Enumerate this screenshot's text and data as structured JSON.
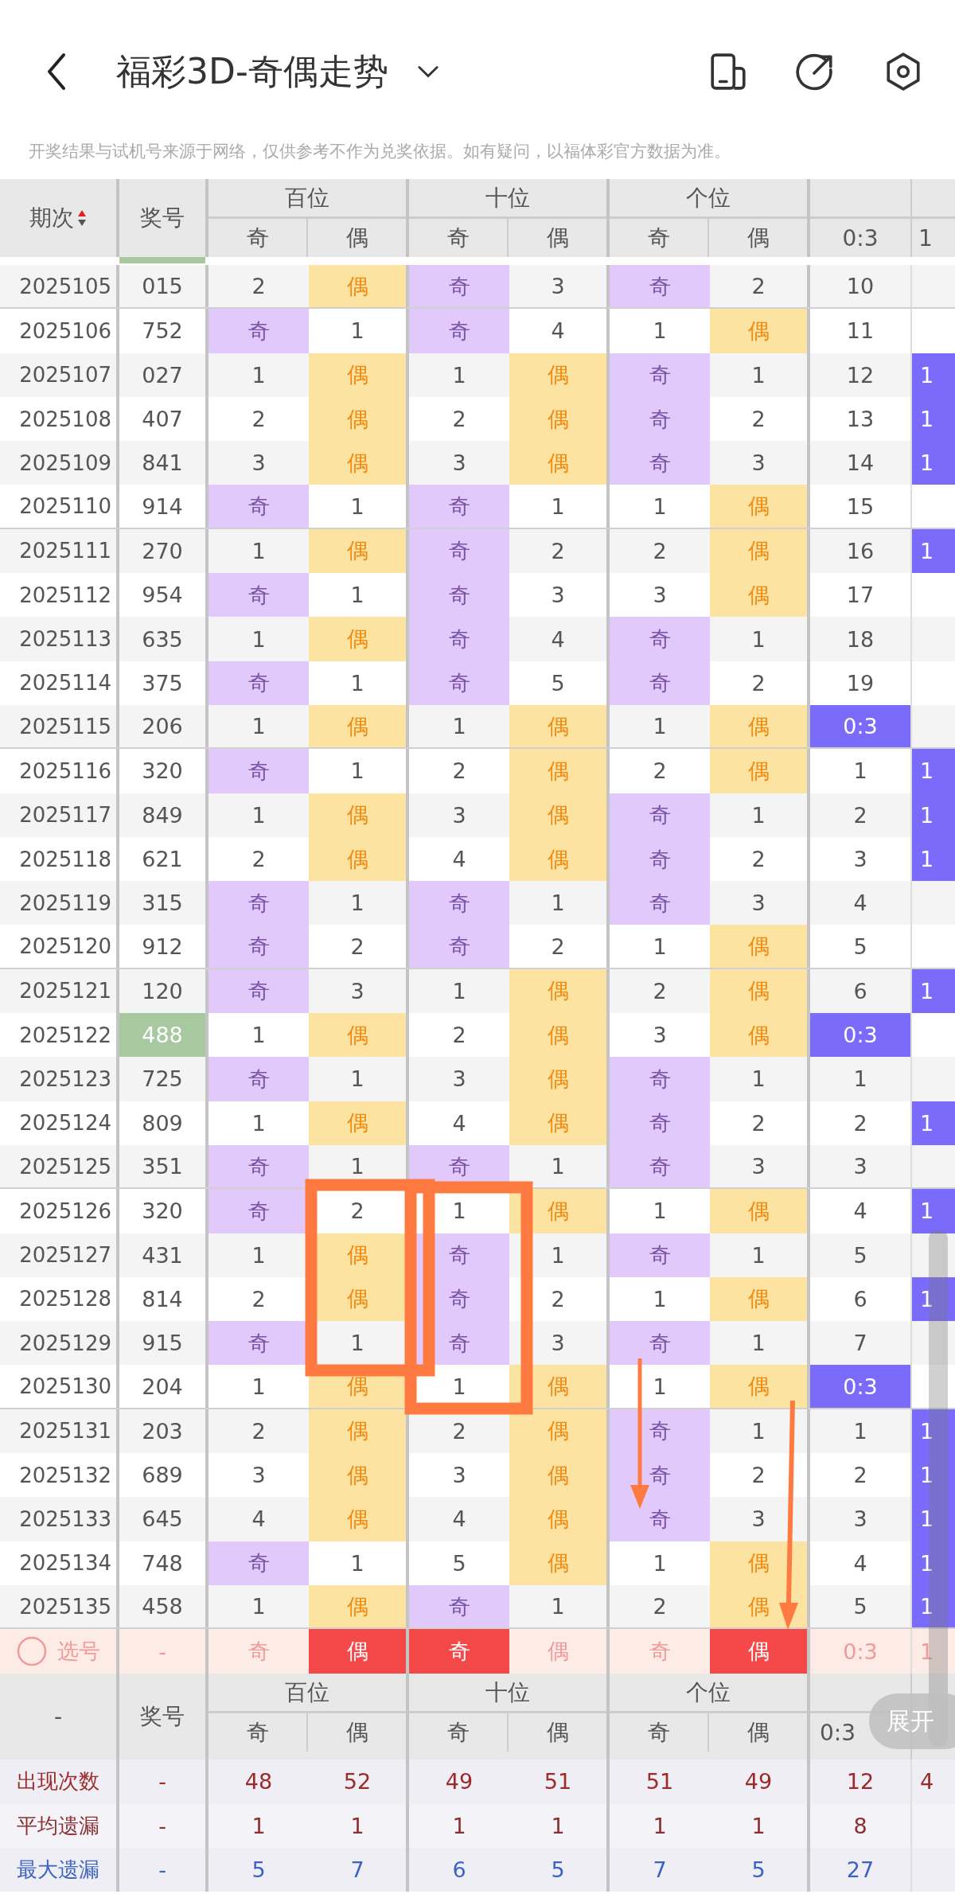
{
  "header": {
    "title": "福彩3D-奇偶走势"
  },
  "disclaimer": "开奖结果与试机号来源于网络，仅供参考不作为兑奖依据。如有疑问，以福体彩官方数据为准。",
  "table": {
    "period_label": "期次",
    "number_label": "奖号",
    "groups": [
      {
        "label": "百位",
        "odd": "奇",
        "even": "偶"
      },
      {
        "label": "十位",
        "odd": "奇",
        "even": "偶"
      },
      {
        "label": "个位",
        "odd": "奇",
        "even": "偶"
      }
    ],
    "ratio_columns": [
      "0:3",
      "1"
    ],
    "rows": [
      {
        "period": "2025105",
        "number": "015",
        "highlighted": false,
        "cells": [
          "2",
          "偶",
          "奇",
          "3",
          "奇",
          "2"
        ],
        "hits": [
          false,
          true,
          true,
          false,
          true,
          false
        ],
        "ratio": "10",
        "ratio_hit": false,
        "column_9_hit": false
      },
      {
        "period": "2025106",
        "number": "752",
        "highlighted": false,
        "cells": [
          "奇",
          "1",
          "奇",
          "4",
          "1",
          "偶"
        ],
        "hits": [
          true,
          false,
          true,
          false,
          false,
          true
        ],
        "ratio": "11",
        "ratio_hit": false,
        "column_9_hit": false
      },
      {
        "period": "2025107",
        "number": "027",
        "highlighted": false,
        "cells": [
          "1",
          "偶",
          "1",
          "偶",
          "奇",
          "1"
        ],
        "hits": [
          false,
          true,
          false,
          true,
          true,
          false
        ],
        "ratio": "12",
        "ratio_hit": false,
        "column_9_hit": true,
        "column_9": "1"
      },
      {
        "period": "2025108",
        "number": "407",
        "highlighted": false,
        "cells": [
          "2",
          "偶",
          "2",
          "偶",
          "奇",
          "2"
        ],
        "hits": [
          false,
          true,
          false,
          true,
          true,
          false
        ],
        "ratio": "13",
        "ratio_hit": false,
        "column_9_hit": true,
        "column_9": "1"
      },
      {
        "period": "2025109",
        "number": "841",
        "highlighted": false,
        "cells": [
          "3",
          "偶",
          "3",
          "偶",
          "奇",
          "3"
        ],
        "hits": [
          false,
          true,
          false,
          true,
          true,
          false
        ],
        "ratio": "14",
        "ratio_hit": false,
        "column_9_hit": true,
        "column_9": "1"
      },
      {
        "period": "2025110",
        "number": "914",
        "highlighted": false,
        "cells": [
          "奇",
          "1",
          "奇",
          "1",
          "1",
          "偶"
        ],
        "hits": [
          true,
          false,
          true,
          false,
          false,
          true
        ],
        "ratio": "15",
        "ratio_hit": false,
        "column_9_hit": false
      },
      {
        "period": "2025111",
        "number": "270",
        "highlighted": false,
        "cells": [
          "1",
          "偶",
          "奇",
          "2",
          "2",
          "偶"
        ],
        "hits": [
          false,
          true,
          true,
          false,
          false,
          true
        ],
        "ratio": "16",
        "ratio_hit": false,
        "column_9_hit": true,
        "column_9": "1"
      },
      {
        "period": "2025112",
        "number": "954",
        "highlighted": false,
        "cells": [
          "奇",
          "1",
          "奇",
          "3",
          "3",
          "偶"
        ],
        "hits": [
          true,
          false,
          true,
          false,
          false,
          true
        ],
        "ratio": "17",
        "ratio_hit": false,
        "column_9_hit": false
      },
      {
        "period": "2025113",
        "number": "635",
        "highlighted": false,
        "cells": [
          "1",
          "偶",
          "奇",
          "4",
          "奇",
          "1"
        ],
        "hits": [
          false,
          true,
          true,
          false,
          true,
          false
        ],
        "ratio": "18",
        "ratio_hit": false,
        "column_9_hit": false
      },
      {
        "period": "2025114",
        "number": "375",
        "highlighted": false,
        "cells": [
          "奇",
          "1",
          "奇",
          "5",
          "奇",
          "2"
        ],
        "hits": [
          true,
          false,
          true,
          false,
          true,
          false
        ],
        "ratio": "19",
        "ratio_hit": false,
        "column_9_hit": false
      },
      {
        "period": "2025115",
        "number": "206",
        "highlighted": false,
        "cells": [
          "1",
          "偶",
          "1",
          "偶",
          "1",
          "偶"
        ],
        "hits": [
          false,
          true,
          false,
          true,
          false,
          true
        ],
        "ratio": "0:3",
        "ratio_hit": true,
        "column_9_hit": false
      },
      {
        "period": "2025116",
        "number": "320",
        "highlighted": false,
        "cells": [
          "奇",
          "1",
          "2",
          "偶",
          "2",
          "偶"
        ],
        "hits": [
          true,
          false,
          false,
          true,
          false,
          true
        ],
        "ratio": "1",
        "ratio_hit": false,
        "column_9_hit": true,
        "column_9": "1"
      },
      {
        "period": "2025117",
        "number": "849",
        "highlighted": false,
        "cells": [
          "1",
          "偶",
          "3",
          "偶",
          "奇",
          "1"
        ],
        "hits": [
          false,
          true,
          false,
          true,
          true,
          false
        ],
        "ratio": "2",
        "ratio_hit": false,
        "column_9_hit": true,
        "column_9": "1"
      },
      {
        "period": "2025118",
        "number": "621",
        "highlighted": false,
        "cells": [
          "2",
          "偶",
          "4",
          "偶",
          "奇",
          "2"
        ],
        "hits": [
          false,
          true,
          false,
          true,
          true,
          false
        ],
        "ratio": "3",
        "ratio_hit": false,
        "column_9_hit": true,
        "column_9": "1"
      },
      {
        "period": "2025119",
        "number": "315",
        "highlighted": false,
        "cells": [
          "奇",
          "1",
          "奇",
          "1",
          "奇",
          "3"
        ],
        "hits": [
          true,
          false,
          true,
          false,
          true,
          false
        ],
        "ratio": "4",
        "ratio_hit": false,
        "column_9_hit": false
      },
      {
        "period": "2025120",
        "number": "912",
        "highlighted": false,
        "cells": [
          "奇",
          "2",
          "奇",
          "2",
          "1",
          "偶"
        ],
        "hits": [
          true,
          false,
          true,
          false,
          false,
          true
        ],
        "ratio": "5",
        "ratio_hit": false,
        "column_9_hit": false
      },
      {
        "period": "2025121",
        "number": "120",
        "highlighted": false,
        "cells": [
          "奇",
          "3",
          "1",
          "偶",
          "2",
          "偶"
        ],
        "hits": [
          true,
          false,
          false,
          true,
          false,
          true
        ],
        "ratio": "6",
        "ratio_hit": false,
        "column_9_hit": true,
        "column_9": "1"
      },
      {
        "period": "2025122",
        "number": "488",
        "highlighted": true,
        "cells": [
          "1",
          "偶",
          "2",
          "偶",
          "3",
          "偶"
        ],
        "hits": [
          false,
          true,
          false,
          true,
          false,
          true
        ],
        "ratio": "0:3",
        "ratio_hit": true,
        "column_9_hit": false
      },
      {
        "period": "2025123",
        "number": "725",
        "highlighted": false,
        "cells": [
          "奇",
          "1",
          "3",
          "偶",
          "奇",
          "1"
        ],
        "hits": [
          true,
          false,
          false,
          true,
          true,
          false
        ],
        "ratio": "1",
        "ratio_hit": false,
        "column_9_hit": false
      },
      {
        "period": "2025124",
        "number": "809",
        "highlighted": false,
        "cells": [
          "1",
          "偶",
          "4",
          "偶",
          "奇",
          "2"
        ],
        "hits": [
          false,
          true,
          false,
          true,
          true,
          false
        ],
        "ratio": "2",
        "ratio_hit": false,
        "column_9_hit": true,
        "column_9": "1"
      },
      {
        "period": "2025125",
        "number": "351",
        "highlighted": false,
        "cells": [
          "奇",
          "1",
          "奇",
          "1",
          "奇",
          "3"
        ],
        "hits": [
          true,
          false,
          true,
          false,
          true,
          false
        ],
        "ratio": "3",
        "ratio_hit": false,
        "column_9_hit": false
      },
      {
        "period": "2025126",
        "number": "320",
        "highlighted": false,
        "cells": [
          "奇",
          "2",
          "1",
          "偶",
          "1",
          "偶"
        ],
        "hits": [
          true,
          false,
          false,
          true,
          false,
          true
        ],
        "ratio": "4",
        "ratio_hit": false,
        "column_9_hit": true,
        "column_9": "1"
      },
      {
        "period": "2025127",
        "number": "431",
        "highlighted": false,
        "cells": [
          "1",
          "偶",
          "奇",
          "1",
          "奇",
          "1"
        ],
        "hits": [
          false,
          true,
          true,
          false,
          true,
          false
        ],
        "ratio": "5",
        "ratio_hit": false,
        "column_9_hit": false
      },
      {
        "period": "2025128",
        "number": "814",
        "highlighted": false,
        "cells": [
          "2",
          "偶",
          "奇",
          "2",
          "1",
          "偶"
        ],
        "hits": [
          false,
          true,
          true,
          false,
          false,
          true
        ],
        "ratio": "6",
        "ratio_hit": false,
        "column_9_hit": true,
        "column_9": "1"
      },
      {
        "period": "2025129",
        "number": "915",
        "highlighted": false,
        "cells": [
          "奇",
          "1",
          "奇",
          "3",
          "奇",
          "1"
        ],
        "hits": [
          true,
          false,
          true,
          false,
          true,
          false
        ],
        "ratio": "7",
        "ratio_hit": false,
        "column_9_hit": false
      },
      {
        "period": "2025130",
        "number": "204",
        "highlighted": false,
        "cells": [
          "1",
          "偶",
          "1",
          "偶",
          "1",
          "偶"
        ],
        "hits": [
          false,
          true,
          false,
          true,
          false,
          true
        ],
        "ratio": "0:3",
        "ratio_hit": true,
        "column_9_hit": false
      },
      {
        "period": "2025131",
        "number": "203",
        "highlighted": false,
        "cells": [
          "2",
          "偶",
          "2",
          "偶",
          "奇",
          "1"
        ],
        "hits": [
          false,
          true,
          false,
          true,
          true,
          false
        ],
        "ratio": "1",
        "ratio_hit": false,
        "column_9_hit": true,
        "column_9": "1"
      },
      {
        "period": "2025132",
        "number": "689",
        "highlighted": false,
        "cells": [
          "3",
          "偶",
          "3",
          "偶",
          "奇",
          "2"
        ],
        "hits": [
          false,
          true,
          false,
          true,
          true,
          false
        ],
        "ratio": "2",
        "ratio_hit": false,
        "column_9_hit": true,
        "column_9": "1"
      },
      {
        "period": "2025133",
        "number": "645",
        "highlighted": false,
        "cells": [
          "4",
          "偶",
          "4",
          "偶",
          "奇",
          "3"
        ],
        "hits": [
          false,
          true,
          false,
          true,
          true,
          false
        ],
        "ratio": "3",
        "ratio_hit": false,
        "column_9_hit": true,
        "column_9": "1"
      },
      {
        "period": "2025134",
        "number": "748",
        "highlighted": false,
        "cells": [
          "奇",
          "1",
          "5",
          "偶",
          "1",
          "偶"
        ],
        "hits": [
          true,
          false,
          false,
          true,
          false,
          true
        ],
        "ratio": "4",
        "ratio_hit": false,
        "column_9_hit": true,
        "column_9": "1"
      },
      {
        "period": "2025135",
        "number": "458",
        "highlighted": false,
        "cells": [
          "1",
          "偶",
          "奇",
          "1",
          "2",
          "偶"
        ],
        "hits": [
          false,
          true,
          true,
          false,
          false,
          true
        ],
        "ratio": "5",
        "ratio_hit": false,
        "column_9_hit": true,
        "column_9": "1"
      }
    ],
    "selection": {
      "label": "选号",
      "number": "-",
      "cells": [
        {
          "text": "奇",
          "selected": false
        },
        {
          "text": "偶",
          "selected": true
        },
        {
          "text": "奇",
          "selected": true
        },
        {
          "text": "偶",
          "selected": false
        },
        {
          "text": "奇",
          "selected": false
        },
        {
          "text": "偶",
          "selected": true
        }
      ],
      "ratio": "0:3",
      "column_9": "1"
    },
    "footer": {
      "label": "-",
      "number_label": "奖号",
      "groups": [
        {
          "label": "百位",
          "odd": "奇",
          "even": "偶"
        },
        {
          "label": "十位",
          "odd": "奇",
          "even": "偶"
        },
        {
          "label": "个位",
          "odd": "奇",
          "even": "偶"
        }
      ],
      "ratio_column": "0:3"
    },
    "stats": [
      {
        "kind": "count",
        "label": "出现次数",
        "number": "-",
        "values": [
          "48",
          "52",
          "49",
          "51",
          "51",
          "49"
        ],
        "ratio": "12",
        "column_9": "4"
      },
      {
        "kind": "avg",
        "label": "平均遗漏",
        "number": "-",
        "values": [
          "1",
          "1",
          "1",
          "1",
          "1",
          "1"
        ],
        "ratio": "8"
      },
      {
        "kind": "max",
        "label": "最大遗漏",
        "number": "-",
        "values": [
          "5",
          "7",
          "6",
          "5",
          "7",
          "5"
        ],
        "ratio": "27"
      }
    ]
  },
  "expand_button": "展开"
}
